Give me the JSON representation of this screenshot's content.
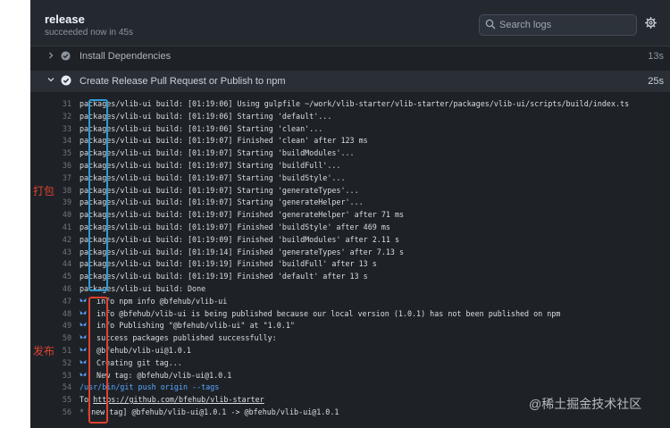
{
  "header": {
    "title": "release",
    "subtitle": "succeeded now in 45s",
    "search_placeholder": "Search logs"
  },
  "steps": [
    {
      "label": "Install Dependencies",
      "time": "13s",
      "expanded": false
    },
    {
      "label": "Create Release Pull Request or Publish to npm",
      "time": "25s",
      "expanded": true
    }
  ],
  "log": [
    {
      "n": "31",
      "text": "packages/vlib-ui build: [01:19:06] Using gulpfile ~/work/vlib-starter/vlib-starter/packages/vlib-ui/scripts/build/index.ts"
    },
    {
      "n": "32",
      "text": "packages/vlib-ui build: [01:19:06] Starting 'default'..."
    },
    {
      "n": "33",
      "text": "packages/vlib-ui build: [01:19:06] Starting 'clean'..."
    },
    {
      "n": "34",
      "text": "packages/vlib-ui build: [01:19:07] Finished 'clean' after 123 ms"
    },
    {
      "n": "35",
      "text": "packages/vlib-ui build: [01:19:07] Starting 'buildModules'..."
    },
    {
      "n": "36",
      "text": "packages/vlib-ui build: [01:19:07] Starting 'buildFull'..."
    },
    {
      "n": "37",
      "text": "packages/vlib-ui build: [01:19:07] Starting 'buildStyle'..."
    },
    {
      "n": "38",
      "text": "packages/vlib-ui build: [01:19:07] Starting 'generateTypes'..."
    },
    {
      "n": "39",
      "text": "packages/vlib-ui build: [01:19:07] Starting 'generateHelper'..."
    },
    {
      "n": "40",
      "text": "packages/vlib-ui build: [01:19:07] Finished 'generateHelper' after 71 ms"
    },
    {
      "n": "41",
      "text": "packages/vlib-ui build: [01:19:07] Finished 'buildStyle' after 469 ms"
    },
    {
      "n": "42",
      "text": "packages/vlib-ui build: [01:19:09] Finished 'buildModules' after 2.11 s"
    },
    {
      "n": "43",
      "text": "packages/vlib-ui build: [01:19:14] Finished 'generateTypes' after 7.13 s"
    },
    {
      "n": "44",
      "text": "packages/vlib-ui build: [01:19:19] Finished 'buildFull' after 13 s"
    },
    {
      "n": "45",
      "text": "packages/vlib-ui build: [01:19:19] Finished 'default' after 13 s"
    },
    {
      "n": "46",
      "text": "packages/vlib-ui build: Done"
    },
    {
      "n": "47",
      "text": " info npm info @bfehub/vlib-ui",
      "icon": true
    },
    {
      "n": "48",
      "text": " info @bfehub/vlib-ui is being published because our local version (1.0.1) has not been published on npm",
      "icon": true
    },
    {
      "n": "49",
      "text": " info Publishing \"@bfehub/vlib-ui\" at \"1.0.1\"",
      "icon": true
    },
    {
      "n": "50",
      "text": " success packages published successfully:",
      "icon": true
    },
    {
      "n": "51",
      "text": " @bfehub/vlib-ui@1.0.1",
      "icon": true
    },
    {
      "n": "52",
      "text": " Creating git tag...",
      "icon": true
    },
    {
      "n": "53",
      "text": " New tag:  @bfehub/vlib-ui@1.0.1",
      "icon": true
    },
    {
      "n": "54",
      "text": "/usr/bin/git push origin --tags",
      "cmd": true
    },
    {
      "n": "55",
      "text_prefix": "To ",
      "link": "https://github.com/bfehub/vlib-starter"
    },
    {
      "n": "56",
      "text": "[new tag]         @bfehub/vlib-ui@1.0.1 -> @bfehub/vlib-ui@1.0.1",
      "dot": "*"
    }
  ],
  "annotations": {
    "build": "打包",
    "publish": "发布"
  },
  "watermark": "@稀土掘金技术社区",
  "colors": {
    "panel_bg": "#1e2227",
    "blue_box": "#2e9bd6",
    "red_box": "#e0412e",
    "link_cmd": "#58a6ff"
  }
}
